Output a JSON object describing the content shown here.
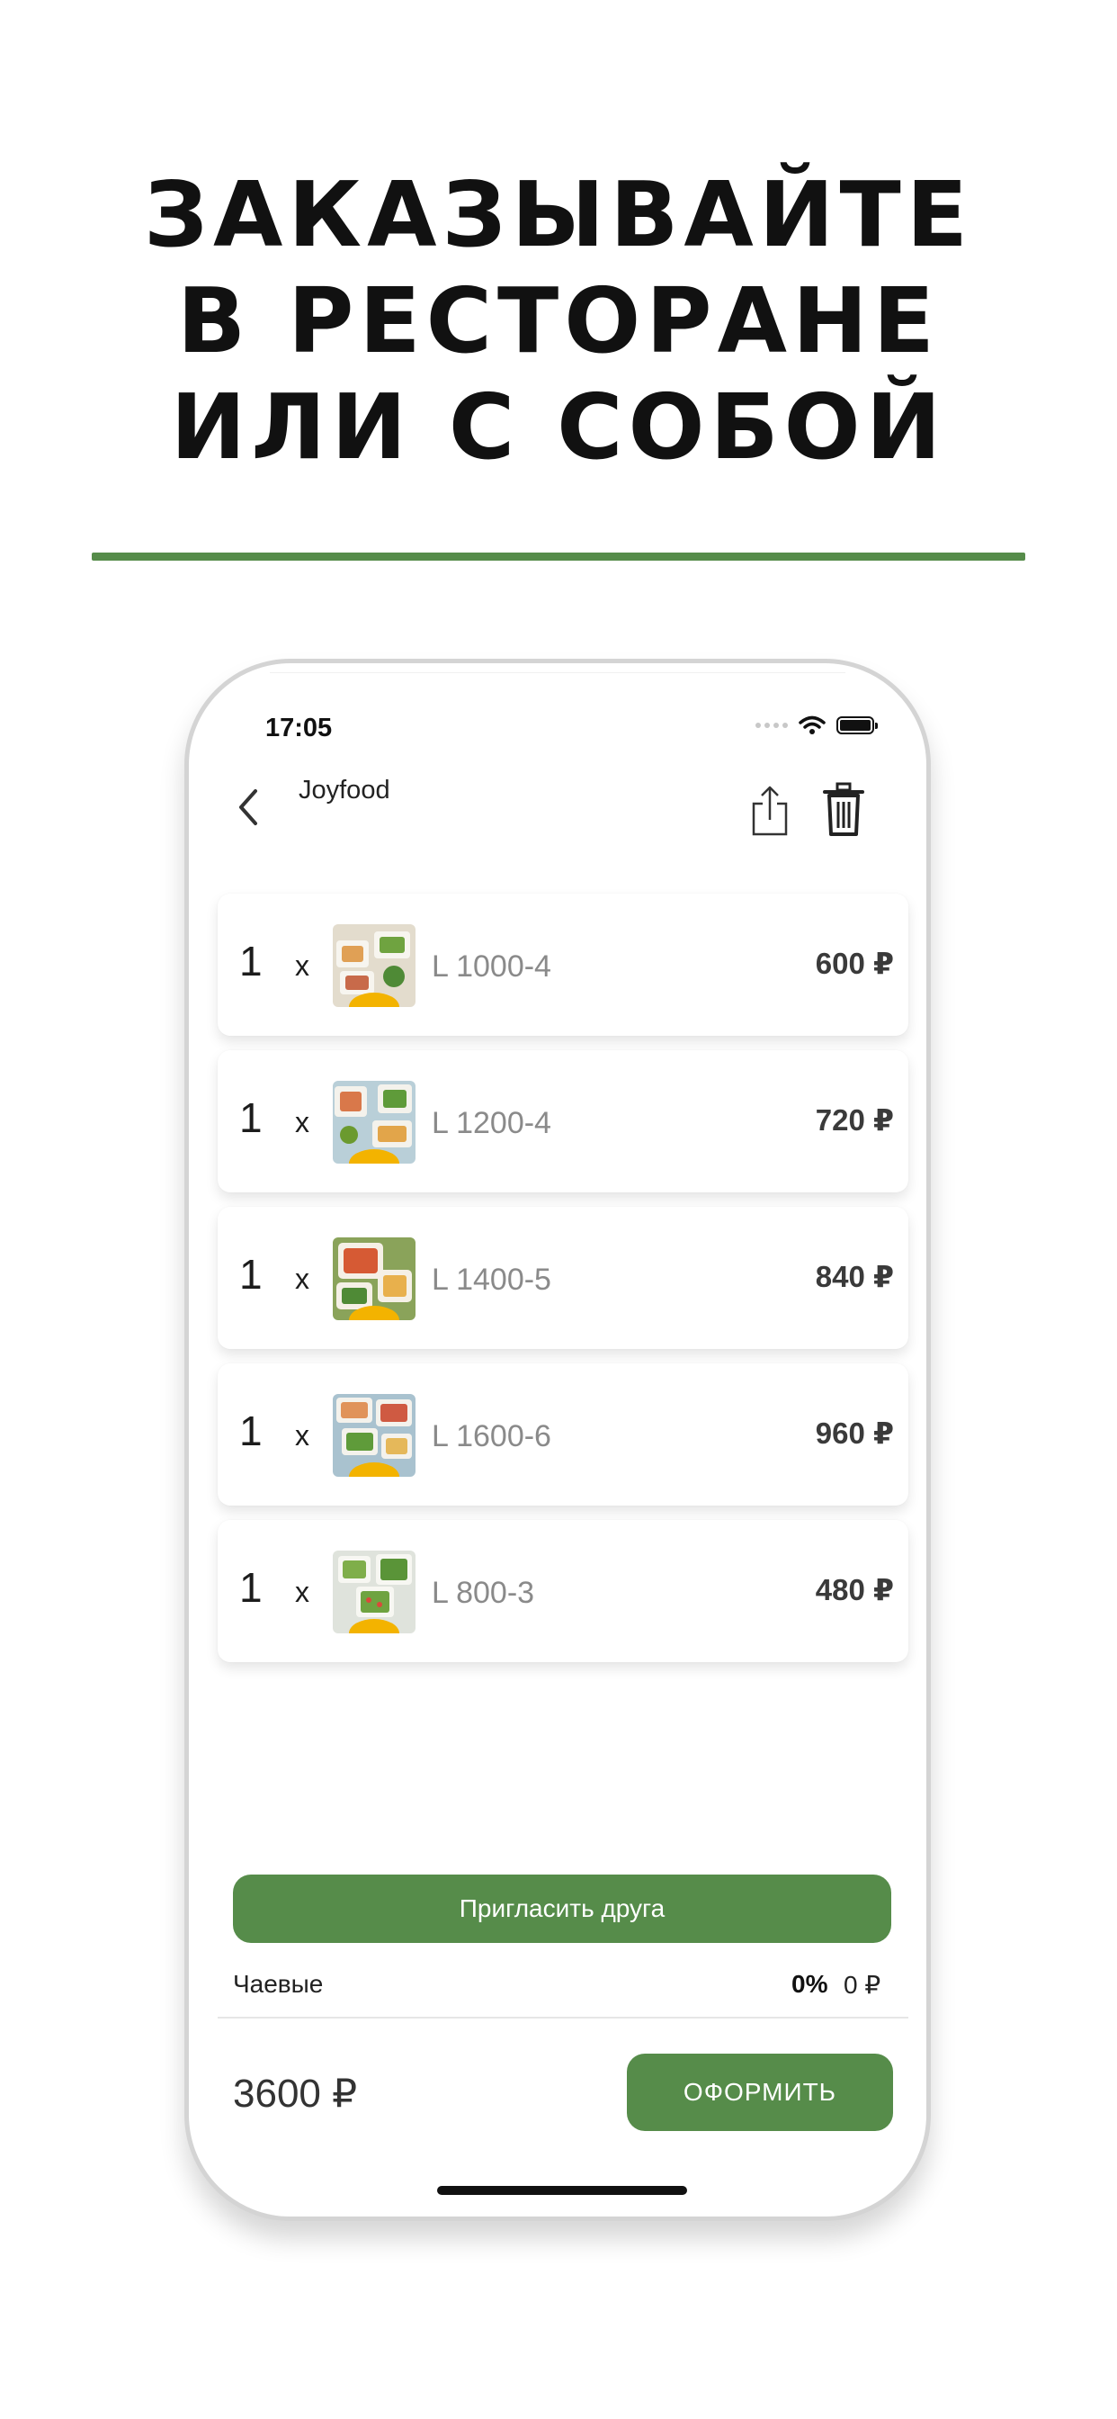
{
  "headline": {
    "line1": "ЗАКАЗЫВАЙТЕ",
    "line2": "В РЕСТОРАНЕ",
    "line3": "ИЛИ С СОБОЙ"
  },
  "colors": {
    "accent": "#568c4a",
    "divider": "#568c4a"
  },
  "status_bar": {
    "time": "17:05",
    "icons": [
      "signal-icon",
      "wifi-icon",
      "battery-icon"
    ]
  },
  "nav": {
    "title": "Joyfood",
    "back_icon": "chevron-left-icon",
    "share_icon": "share-icon",
    "delete_icon": "trash-icon"
  },
  "cart": {
    "times_symbol": "x",
    "items": [
      {
        "qty": "1",
        "name": "L 1000-4",
        "price": "600 ₽"
      },
      {
        "qty": "1",
        "name": "L 1200-4",
        "price": "720 ₽"
      },
      {
        "qty": "1",
        "name": "L 1400-5",
        "price": "840 ₽"
      },
      {
        "qty": "1",
        "name": "L 1600-6",
        "price": "960 ₽"
      },
      {
        "qty": "1",
        "name": "L 800-3",
        "price": "480 ₽"
      }
    ]
  },
  "invite_button": "Пригласить друга",
  "tips": {
    "label": "Чаевые",
    "percent": "0%",
    "amount": "0 ₽"
  },
  "footer": {
    "total": "3600 ₽",
    "checkout_button": "ОФОРМИТЬ"
  }
}
